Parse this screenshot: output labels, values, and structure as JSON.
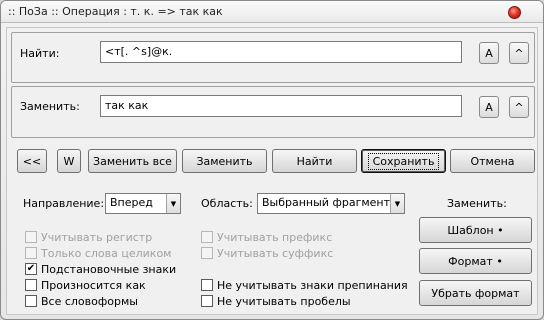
{
  "window": {
    "title": ":: ПоЗа :: Операция : т. к. => так как"
  },
  "find": {
    "label": "Найти:",
    "value": "<т[. ^s]@к.",
    "case_button": "A",
    "up_button": "^"
  },
  "replace": {
    "label": "Заменить:",
    "value": "так как",
    "case_button": "A",
    "up_button": "^"
  },
  "toolbar": {
    "prev": "<<",
    "word": "W",
    "replace_all": "Заменить все",
    "replace": "Заменить",
    "find": "Найти",
    "save": "Сохранить",
    "cancel": "Отмена"
  },
  "options": {
    "direction_label": "Направление:",
    "direction_value": "Вперед",
    "scope_label": "Область:",
    "scope_value": "Выбранный фрагмент",
    "replace_label": "Заменить:",
    "template_button": "Шаблон",
    "format_button": "Формат",
    "clear_format_button": "Убрать формат",
    "bullet": "•",
    "checked_mark": "✔",
    "left_checks": [
      {
        "label": "Учитывать регистр",
        "checked": false,
        "disabled": true
      },
      {
        "label": "Только слова целиком",
        "checked": false,
        "disabled": true
      },
      {
        "label": "Подстановочные знаки",
        "checked": true,
        "disabled": false
      },
      {
        "label": "Произносится как",
        "checked": false,
        "disabled": false
      },
      {
        "label": "Все словоформы",
        "checked": false,
        "disabled": false
      }
    ],
    "right_checks": [
      {
        "label": "Учитывать префикс",
        "checked": false,
        "disabled": true
      },
      {
        "label": "Учитывать суффикс",
        "checked": false,
        "disabled": true
      },
      {
        "label": "Не учитывать знаки препинания",
        "checked": false,
        "disabled": false
      },
      {
        "label": "Не учитывать пробелы",
        "checked": false,
        "disabled": false
      }
    ]
  }
}
